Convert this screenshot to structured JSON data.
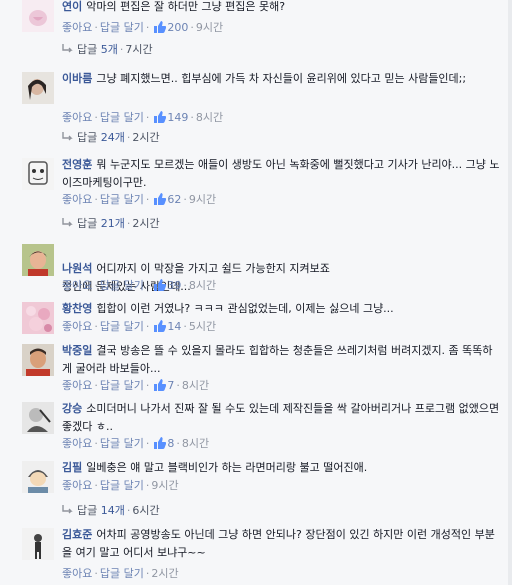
{
  "labels": {
    "like": "좋아요",
    "reply": "답글 달기",
    "dot": "·",
    "replies_prefix": "답글"
  },
  "comments": [
    {
      "name": "연이",
      "text": "악마의 편집은 잘 하더만 그냥 편집은 못해?",
      "likes": "200",
      "time": "9시간",
      "replies": "5개",
      "reply_time": "7시간"
    },
    {
      "name": "이바름",
      "text": "그냥 폐지했느면.. 힙부심에 가득 차 자신들이 윤리위에 있다고 믿는 사람들인데;;",
      "likes": "149",
      "time": "8시간",
      "replies": "24개",
      "reply_time": "2시간"
    },
    {
      "name": "전영훈",
      "text": "뭐 누군지도 모르겠는 애들이 생방도 아닌 녹화중에 뻘짓했다고 기사가 난리야... 그냥 노이즈마케팅이구만.",
      "likes": "62",
      "time": "9시간",
      "replies": "21개",
      "reply_time": "2시간"
    },
    {
      "name": "나원석",
      "text": "어디까지 이 막장을 가지고 쉴드 가능한지 지켜보죠\n정신에 문제있는 사람인데...",
      "likes": "39",
      "time": "8시간"
    },
    {
      "name": "황찬영",
      "text": "힙합이 이런 거였나? ㅋㅋㅋ 관심없었는데, 이제는 싫으네 그냥...",
      "likes": "14",
      "time": "5시간"
    },
    {
      "name": "박중일",
      "text": "결국 방송은 뜰 수 있을지 몰라도 힙합하는 청춘들은 쓰레기처럼 버려지겠지. 좀 똑똑하게 굴어라 바보들아...",
      "likes": "7",
      "time": "8시간"
    },
    {
      "name": "강승",
      "text": "소미더머니 나가서 진짜 잘 될 수도 있는데 제작진들을 싹 갈아버리거나 프로그램 없앴으면 좋겠다 ㅎ..",
      "likes": "8",
      "time": "8시간"
    },
    {
      "name": "김필",
      "text": "일베충은 얘 말고 블랙비인가 하는 라면머리랑 불고 떨어진애.",
      "time": "9시간",
      "replies": "14개",
      "reply_time": "6시간"
    },
    {
      "name": "김효준",
      "text": "어차피 공영방송도 아닌데 그냥 하면 안되나? 장단점이 있긴 하지만 이런 개성적인 부분을 여기 말고 어디서 보냐구~~",
      "time": "2시간"
    }
  ],
  "colors": {
    "name": "#3b5998",
    "link": "#6d84b4",
    "meta": "#9197a3",
    "bg": "#f6f7f9"
  },
  "icons": {
    "like": "thumbs-up-icon",
    "reply": "reply-arrow-icon"
  }
}
